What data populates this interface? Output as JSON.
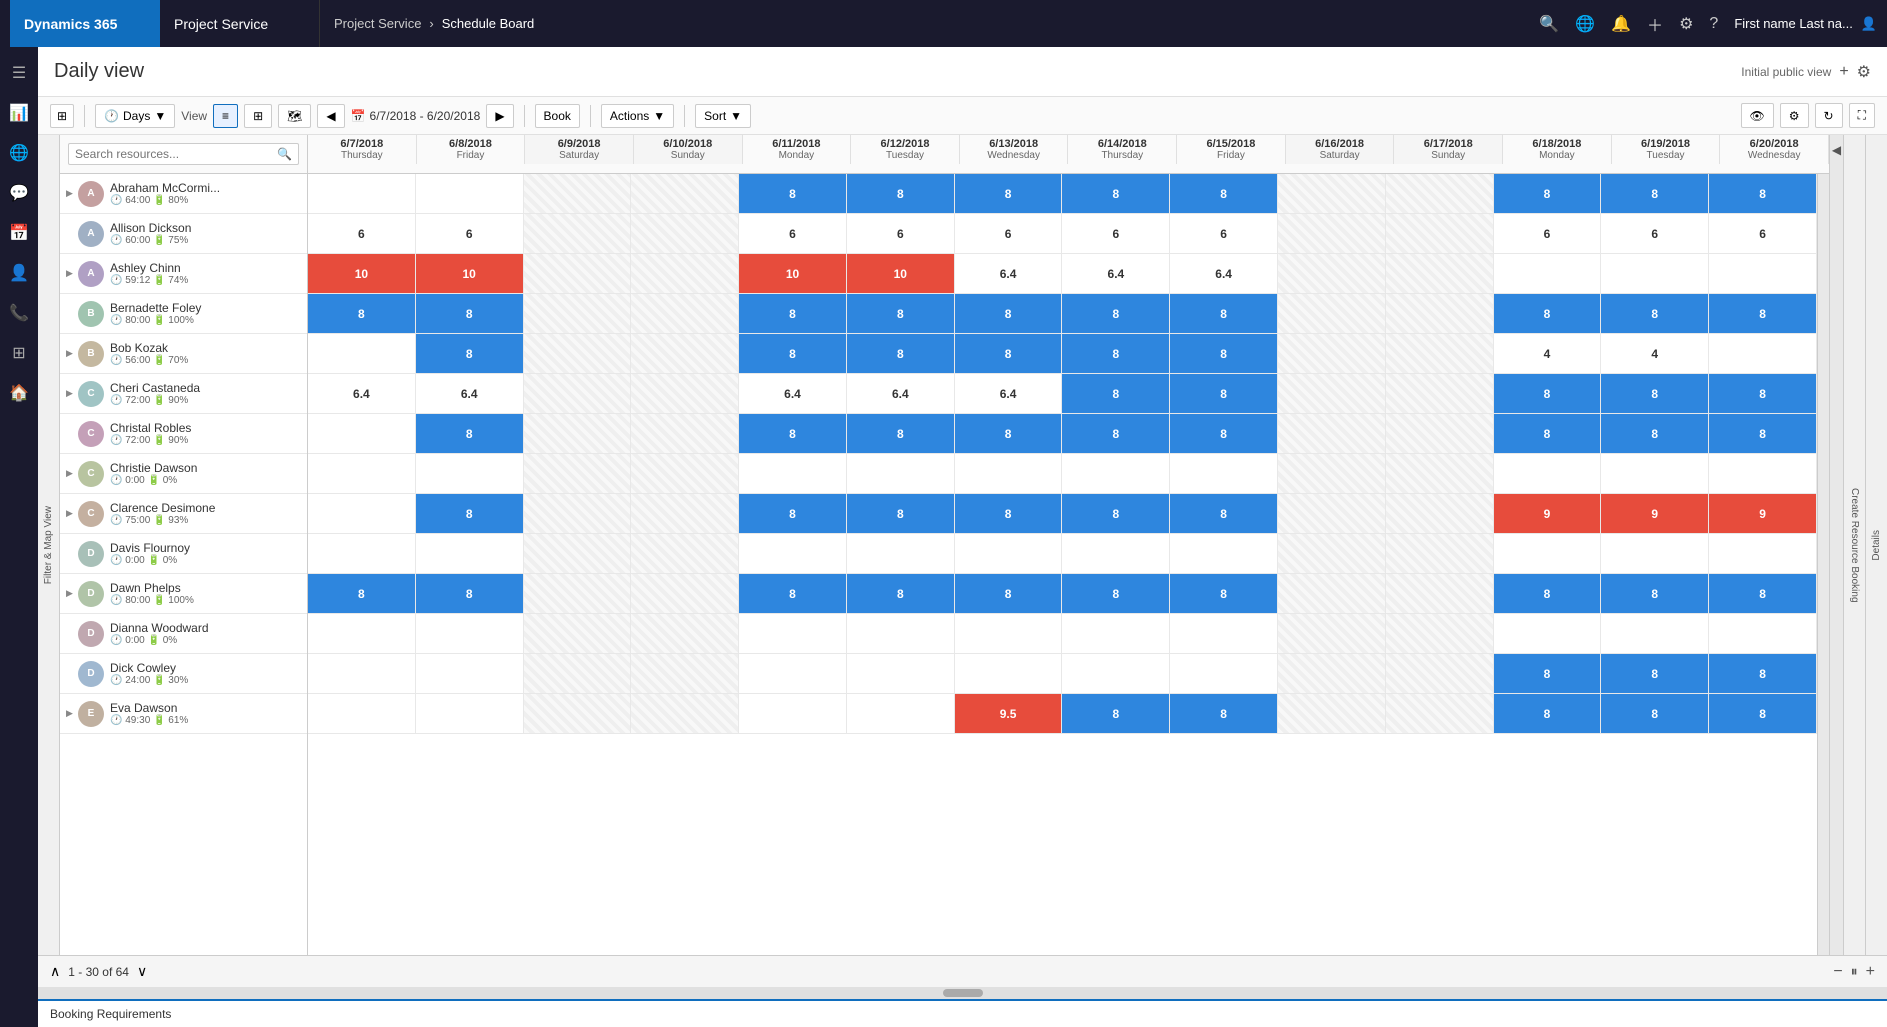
{
  "topNav": {
    "dynamics365": "Dynamics 365",
    "projectService": "Project Service",
    "breadcrumb": {
      "parent": "Project Service",
      "separator": "›",
      "current": "Schedule Board"
    },
    "userLabel": "First name Last na...",
    "icons": [
      "search",
      "globe",
      "bell",
      "plus",
      "settings",
      "help"
    ]
  },
  "sidebar": {
    "items": [
      "menu",
      "chart",
      "globe",
      "message",
      "calendar",
      "person",
      "phone",
      "grid",
      "home"
    ]
  },
  "page": {
    "title": "Daily view",
    "viewLabel": "Initial public view",
    "addBtn": "+",
    "settingsBtn": "⚙"
  },
  "toolbar": {
    "daysBtn": "Days",
    "viewLabel": "View",
    "calIcon": "📅",
    "dateRange": "6/7/2018 - 6/20/2018",
    "bookBtn": "Book",
    "actionsBtn": "Actions",
    "sortBtn": "Sort",
    "filterMapLabel": "Filter & Map View"
  },
  "search": {
    "placeholder": "Search resources..."
  },
  "dates": [
    {
      "date": "6/7/2018",
      "day": "Thursday",
      "isWeekend": false
    },
    {
      "date": "6/8/2018",
      "day": "Friday",
      "isWeekend": false
    },
    {
      "date": "6/9/2018",
      "day": "Saturday",
      "isWeekend": true
    },
    {
      "date": "6/10/2018",
      "day": "Sunday",
      "isWeekend": true
    },
    {
      "date": "6/11/2018",
      "day": "Monday",
      "isWeekend": false
    },
    {
      "date": "6/12/2018",
      "day": "Tuesday",
      "isWeekend": false
    },
    {
      "date": "6/13/2018",
      "day": "Wednesday",
      "isWeekend": false
    },
    {
      "date": "6/14/2018",
      "day": "Thursday",
      "isWeekend": false
    },
    {
      "date": "6/15/2018",
      "day": "Friday",
      "isWeekend": false
    },
    {
      "date": "6/16/2018",
      "day": "Saturday",
      "isWeekend": true
    },
    {
      "date": "6/17/2018",
      "day": "Sunday",
      "isWeekend": true
    },
    {
      "date": "6/18/2018",
      "day": "Monday",
      "isWeekend": false
    },
    {
      "date": "6/19/2018",
      "day": "Tuesday",
      "isWeekend": false
    },
    {
      "date": "6/20/2018",
      "day": "Wednesday",
      "isWeekend": false
    }
  ],
  "resources": [
    {
      "name": "Abraham McCormi...",
      "meta1": "64:00",
      "meta2": "80%",
      "bookings": [
        "",
        "",
        "W",
        "W",
        "8",
        "8",
        "8",
        "8",
        "8",
        "W",
        "W",
        "8",
        "8",
        "8"
      ],
      "bookingTypes": [
        "",
        "",
        "w",
        "w",
        "b",
        "b",
        "b",
        "b",
        "b",
        "w",
        "w",
        "b",
        "b",
        "b"
      ]
    },
    {
      "name": "Allison Dickson",
      "meta1": "60:00",
      "meta2": "75%",
      "bookings": [
        "6",
        "6",
        "W",
        "W",
        "6",
        "6",
        "6",
        "6",
        "6",
        "W",
        "W",
        "6",
        "6",
        "6"
      ],
      "bookingTypes": [
        "n",
        "n",
        "w",
        "w",
        "n",
        "n",
        "n",
        "n",
        "n",
        "w",
        "w",
        "n",
        "n",
        "n"
      ]
    },
    {
      "name": "Ashley Chinn",
      "meta1": "59:12",
      "meta2": "74%",
      "bookings": [
        "10",
        "10",
        "W",
        "W",
        "10",
        "10",
        "6.4",
        "6.4",
        "6.4",
        "W",
        "W",
        "",
        "",
        ""
      ],
      "bookingTypes": [
        "r",
        "r",
        "w",
        "w",
        "r",
        "r",
        "n",
        "n",
        "n",
        "w",
        "w",
        "",
        "",
        ""
      ]
    },
    {
      "name": "Bernadette Foley",
      "meta1": "80:00",
      "meta2": "100%",
      "bookings": [
        "8",
        "8",
        "W",
        "W",
        "8",
        "8",
        "8",
        "8",
        "8",
        "W",
        "W",
        "8",
        "8",
        "8"
      ],
      "bookingTypes": [
        "b",
        "b",
        "w",
        "w",
        "b",
        "b",
        "b",
        "b",
        "b",
        "w",
        "w",
        "b",
        "b",
        "b"
      ]
    },
    {
      "name": "Bob Kozak",
      "meta1": "56:00",
      "meta2": "70%",
      "bookings": [
        "",
        "8",
        "W",
        "W",
        "8",
        "8",
        "8",
        "8",
        "8",
        "W",
        "W",
        "4",
        "4",
        ""
      ],
      "bookingTypes": [
        "",
        "b",
        "w",
        "w",
        "b",
        "b",
        "b",
        "b",
        "b",
        "w",
        "w",
        "n",
        "n",
        ""
      ]
    },
    {
      "name": "Cheri Castaneda",
      "meta1": "72:00",
      "meta2": "90%",
      "bookings": [
        "6.4",
        "6.4",
        "W",
        "W",
        "6.4",
        "6.4",
        "6.4",
        "8",
        "8",
        "W",
        "W",
        "8",
        "8",
        "8"
      ],
      "bookingTypes": [
        "n",
        "n",
        "w",
        "w",
        "n",
        "n",
        "n",
        "b",
        "b",
        "w",
        "w",
        "b",
        "b",
        "b"
      ]
    },
    {
      "name": "Christal Robles",
      "meta1": "72:00",
      "meta2": "90%",
      "bookings": [
        "",
        "8",
        "W",
        "W",
        "8",
        "8",
        "8",
        "8",
        "8",
        "W",
        "W",
        "8",
        "8",
        "8"
      ],
      "bookingTypes": [
        "",
        "b",
        "w",
        "w",
        "b",
        "b",
        "b",
        "b",
        "b",
        "w",
        "w",
        "b",
        "b",
        "b"
      ]
    },
    {
      "name": "Christie Dawson",
      "meta1": "0:00",
      "meta2": "0%",
      "bookings": [
        "",
        "",
        "W",
        "W",
        "",
        "",
        "",
        "",
        "",
        "W",
        "W",
        "",
        "",
        ""
      ],
      "bookingTypes": [
        "",
        "",
        "w",
        "w",
        "",
        "",
        "",
        "",
        "",
        "w",
        "w",
        "",
        "",
        ""
      ]
    },
    {
      "name": "Clarence Desimone",
      "meta1": "75:00",
      "meta2": "93%",
      "bookings": [
        "",
        "8",
        "W",
        "W",
        "8",
        "8",
        "8",
        "8",
        "8",
        "W",
        "W",
        "9",
        "9",
        "9"
      ],
      "bookingTypes": [
        "",
        "b",
        "w",
        "w",
        "b",
        "b",
        "b",
        "b",
        "b",
        "w",
        "w",
        "r",
        "r",
        "r"
      ]
    },
    {
      "name": "Davis Flournoy",
      "meta1": "0:00",
      "meta2": "0%",
      "bookings": [
        "",
        "",
        "W",
        "W",
        "",
        "",
        "",
        "",
        "",
        "W",
        "W",
        "",
        "",
        ""
      ],
      "bookingTypes": [
        "",
        "",
        "w",
        "w",
        "",
        "",
        "",
        "",
        "",
        "w",
        "w",
        "",
        "",
        ""
      ]
    },
    {
      "name": "Dawn Phelps",
      "meta1": "80:00",
      "meta2": "100%",
      "bookings": [
        "8",
        "8",
        "W",
        "W",
        "8",
        "8",
        "8",
        "8",
        "8",
        "W",
        "W",
        "8",
        "8",
        "8"
      ],
      "bookingTypes": [
        "b",
        "b",
        "w",
        "w",
        "b",
        "b",
        "b",
        "b",
        "b",
        "w",
        "w",
        "b",
        "b",
        "b"
      ]
    },
    {
      "name": "Dianna Woodward",
      "meta1": "0:00",
      "meta2": "0%",
      "bookings": [
        "",
        "",
        "W",
        "W",
        "",
        "",
        "",
        "",
        "",
        "W",
        "W",
        "",
        "",
        ""
      ],
      "bookingTypes": [
        "",
        "",
        "w",
        "w",
        "",
        "",
        "",
        "",
        "",
        "w",
        "w",
        "",
        "",
        ""
      ]
    },
    {
      "name": "Dick Cowley",
      "meta1": "24:00",
      "meta2": "30%",
      "bookings": [
        "",
        "",
        "W",
        "W",
        "",
        "",
        "",
        "",
        "",
        "W",
        "W",
        "8",
        "8",
        "8"
      ],
      "bookingTypes": [
        "",
        "",
        "w",
        "w",
        "",
        "",
        "",
        "",
        "",
        "w",
        "w",
        "b",
        "b",
        "b"
      ]
    },
    {
      "name": "Eva Dawson",
      "meta1": "49:30",
      "meta2": "61%",
      "bookings": [
        "",
        "",
        "W",
        "W",
        "",
        "",
        "9.5",
        "8",
        "8",
        "W",
        "W",
        "8",
        "8",
        "8"
      ],
      "bookingTypes": [
        "",
        "",
        "w",
        "w",
        "",
        "",
        "r",
        "b",
        "b",
        "w",
        "w",
        "b",
        "b",
        "b"
      ]
    }
  ],
  "pagination": {
    "text": "1 - 30 of 64",
    "expandIcon": "∧",
    "collapseIcon": "∨"
  },
  "bookingRequirements": {
    "label": "Booking Requirements"
  },
  "rightPanel": {
    "detailsLabel": "Details",
    "createLabel": "Create Resource Booking"
  },
  "colors": {
    "blue": "#2e86de",
    "red": "#e74c3c",
    "weekend": "#f0f0f0",
    "navBg": "#1a1a2e",
    "dynamics365Bg": "#106ebe"
  }
}
